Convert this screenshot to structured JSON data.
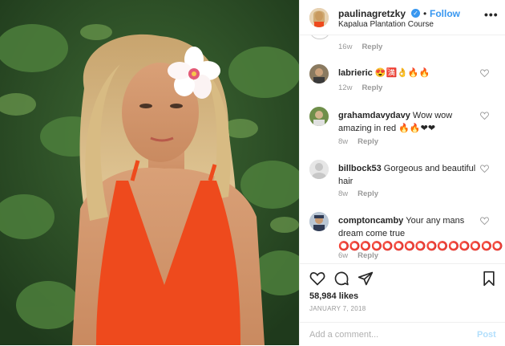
{
  "post": {
    "username": "paulinagretzky",
    "follow_separator": "•",
    "follow_label": "Follow",
    "location": "Kapalua Plantation Course",
    "more_icon": "more-horizontal-icon"
  },
  "comments_panel": {
    "top_meta": {
      "time": "16w",
      "reply": "Reply"
    },
    "comments": [
      {
        "user": "labrieric",
        "text": "😍🈵👌🔥🔥",
        "time": "12w",
        "reply": "Reply"
      },
      {
        "user": "grahamdavydavy",
        "text": "Wow wow amazing in red 🔥🔥❤❤",
        "time": "8w",
        "reply": "Reply"
      },
      {
        "user": "billbock53",
        "text": "Gorgeous and beautiful hair",
        "time": "8w",
        "reply": "Reply"
      },
      {
        "user": "comptoncamby",
        "text": "Your any mans dream come true ⭕⭕⭕⭕⭕⭕⭕⭕⭕⭕⭕⭕⭕⭕⭕",
        "time": "6w",
        "reply": "Reply"
      }
    ]
  },
  "actions": {
    "likes": "58,984 likes",
    "date": "JANUARY 7, 2018",
    "add_comment_placeholder": "Add a comment...",
    "post_label": "Post"
  },
  "colors": {
    "accent_blue": "#3897f0",
    "post_disabled": "#b2dffc",
    "muted_text": "#999999",
    "swimsuit_red": "#ee4a1d"
  }
}
